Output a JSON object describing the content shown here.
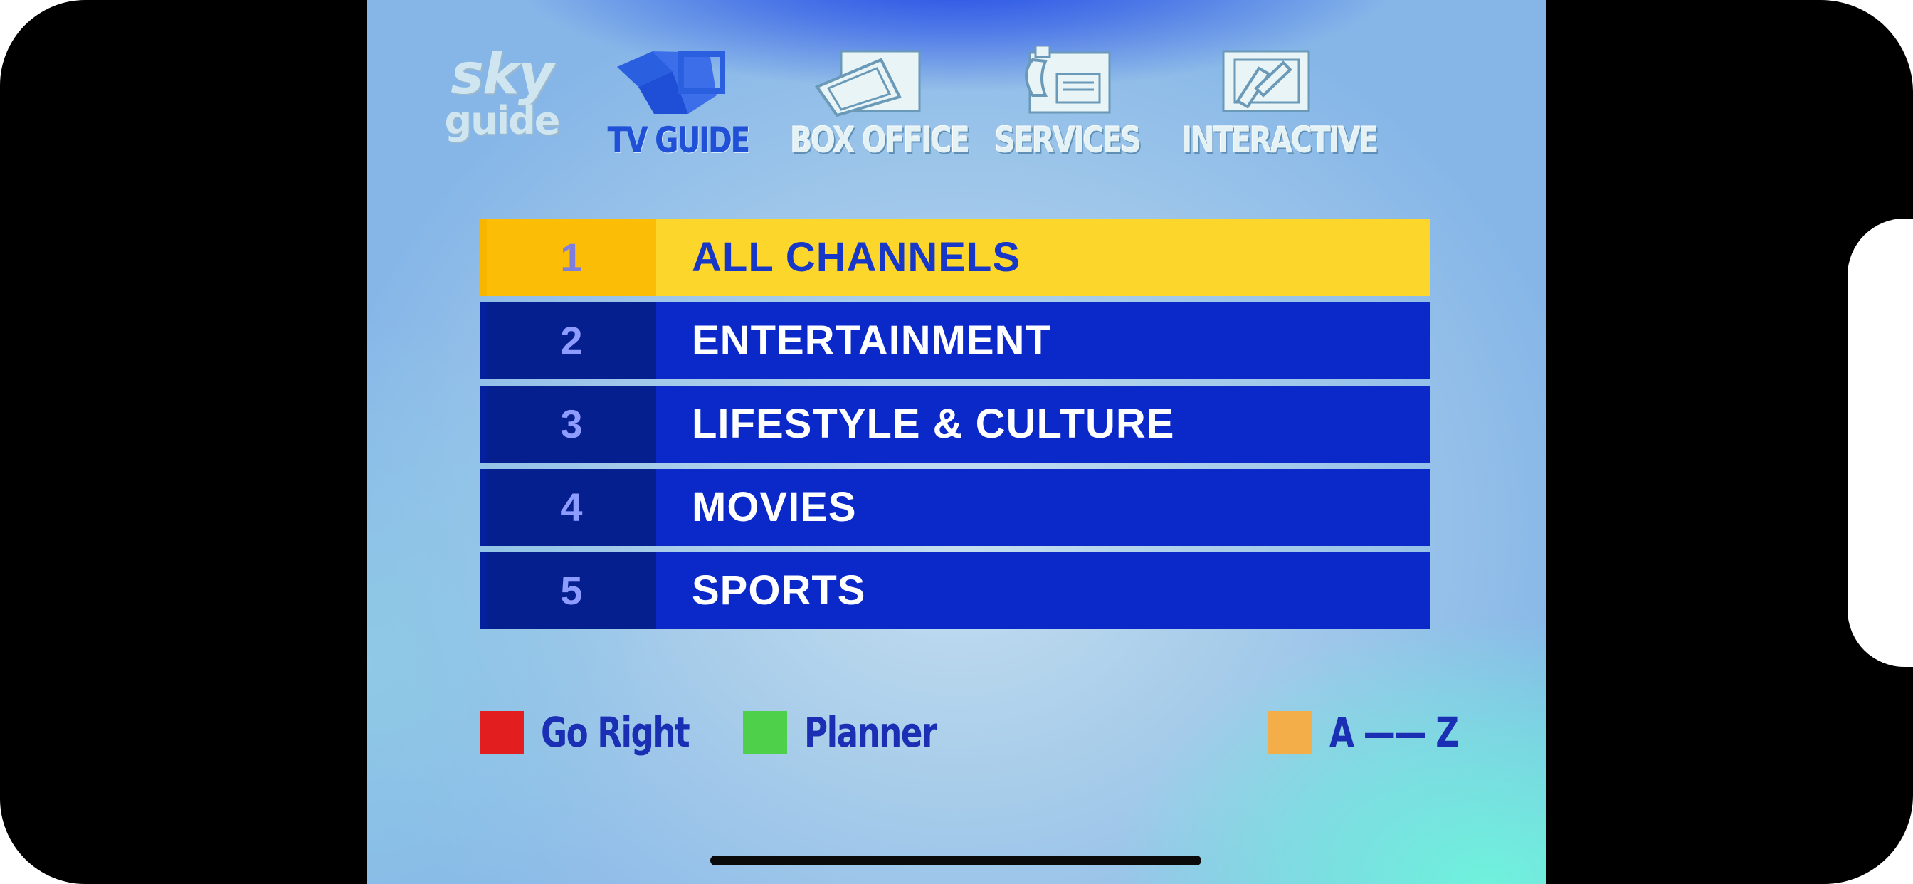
{
  "header": {
    "logo": {
      "line1": "sky",
      "line2": "guide"
    },
    "nav": [
      {
        "label": "TV GUIDE",
        "icon": "tv-guide-icon",
        "active": true
      },
      {
        "label": "BOX OFFICE",
        "icon": "ticket-icon",
        "active": false
      },
      {
        "label": "SERVICES",
        "icon": "phone-icon",
        "active": false
      },
      {
        "label": "INTERACTIVE",
        "icon": "interactive-icon",
        "active": false
      }
    ]
  },
  "menu": {
    "items": [
      {
        "number": "1",
        "label": "ALL CHANNELS",
        "selected": true
      },
      {
        "number": "2",
        "label": "ENTERTAINMENT",
        "selected": false
      },
      {
        "number": "3",
        "label": "LIFESTYLE & CULTURE",
        "selected": false
      },
      {
        "number": "4",
        "label": "MOVIES",
        "selected": false
      },
      {
        "number": "5",
        "label": "SPORTS",
        "selected": false
      }
    ]
  },
  "footer": {
    "red": {
      "label": "Go Right",
      "color": "#e31e1e"
    },
    "green": {
      "label": "Planner",
      "color": "#4fd04a"
    },
    "yellow": {
      "label": "A —— Z",
      "color": "#f3ae4a"
    }
  },
  "colors": {
    "row_bg": "#0a29c8",
    "row_selected_bg": "#fcd62a",
    "accent_blue": "#1637c8"
  }
}
